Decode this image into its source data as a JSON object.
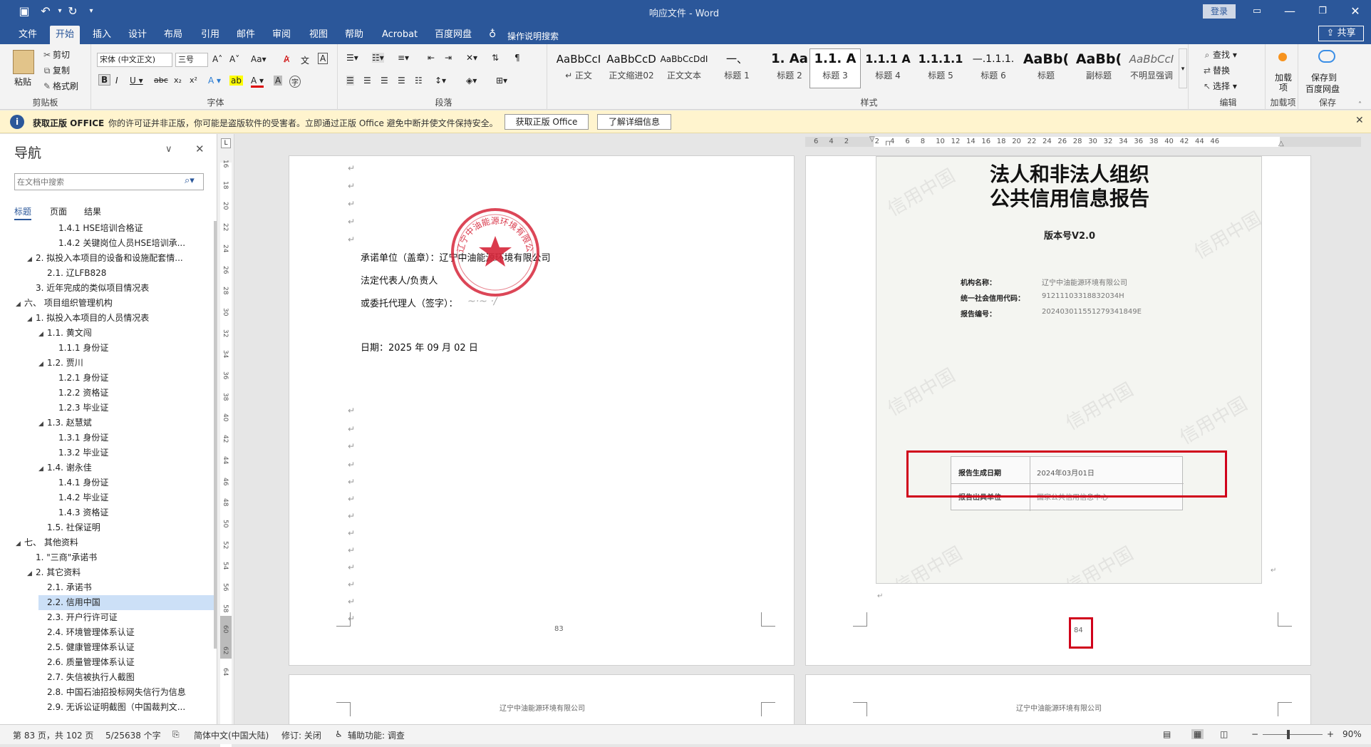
{
  "app": {
    "window_title": "响应文件 - Word",
    "login_label": "登录",
    "share_label": "共享",
    "colors": {
      "accent": "#2b579a",
      "message_bar": "#fff4ce",
      "red_box": "#d0021b"
    }
  },
  "tabs": [
    "文件",
    "开始",
    "插入",
    "设计",
    "布局",
    "引用",
    "邮件",
    "审阅",
    "视图",
    "帮助",
    "Acrobat",
    "百度网盘"
  ],
  "tell_me": "操作说明搜索",
  "ribbon": {
    "clipboard": {
      "paste": "粘贴",
      "cut": "剪切",
      "copy": "复制",
      "format_painter": "格式刷",
      "label": "剪贴板"
    },
    "font": {
      "font_name": "宋体 (中文正文)",
      "font_size": "三号",
      "label": "字体"
    },
    "paragraph": {
      "label": "段落"
    },
    "styles": {
      "label": "样式",
      "items": [
        {
          "preview": "AaBbCcI",
          "name": "↵ 正文"
        },
        {
          "preview": "AaBbCcD",
          "name": "正文缩进02"
        },
        {
          "preview": "AaBbCcDdI",
          "name": "正文文本"
        },
        {
          "preview": "一、",
          "name": "标题 1"
        },
        {
          "preview": "1. Aa",
          "name": "标题 2"
        },
        {
          "preview": "1.1. A",
          "name": "标题 3"
        },
        {
          "preview": "1.1.1 A",
          "name": "标题 4"
        },
        {
          "preview": "1.1.1.1",
          "name": "标题 5"
        },
        {
          "preview": "—.1.1.1.",
          "name": "标题 6"
        },
        {
          "preview": "AaBb(",
          "name": "标题"
        },
        {
          "preview": "AaBb(",
          "name": "副标题"
        },
        {
          "preview": "AaBbCcI",
          "name": "不明显强调"
        }
      ]
    },
    "editing": {
      "find": "查找",
      "replace": "替换",
      "select": "选择",
      "label": "编辑"
    },
    "addins": {
      "btn": "加载项",
      "label": "加载项"
    },
    "save": {
      "btn1": "保存到",
      "btn2": "百度网盘",
      "label": "保存"
    }
  },
  "message_bar": {
    "title": "获取正版 OFFICE",
    "text": "你的许可证并非正版，你可能是盗版软件的受害者。立即通过正版 Office 避免中断并使文件保持安全。",
    "btn_get": "获取正版 Office",
    "btn_learn": "了解详细信息"
  },
  "nav": {
    "title": "导航",
    "search_placeholder": "在文档中搜索",
    "tabs": [
      "标题",
      "页面",
      "结果"
    ],
    "items": [
      {
        "text": "1.4.1 HSE培训合格证",
        "level": 4,
        "tri": ""
      },
      {
        "text": "1.4.2 关键岗位人员HSE培训承...",
        "level": 4,
        "tri": ""
      },
      {
        "text": "2. 拟投入本项目的设备和设施配套情...",
        "level": 2,
        "tri": "◢"
      },
      {
        "text": "2.1. 辽LFB828",
        "level": 3,
        "tri": ""
      },
      {
        "text": "3. 近年完成的类似项目情况表",
        "level": 2,
        "tri": ""
      },
      {
        "text": "六、 项目组织管理机构",
        "level": 1,
        "tri": "◢"
      },
      {
        "text": "1. 拟投入本项目的人员情况表",
        "level": 2,
        "tri": "◢"
      },
      {
        "text": "1.1. 黄文闯",
        "level": 3,
        "tri": "◢"
      },
      {
        "text": "1.1.1 身份证",
        "level": 4,
        "tri": ""
      },
      {
        "text": "1.2. 贾川",
        "level": 3,
        "tri": "◢"
      },
      {
        "text": "1.2.1 身份证",
        "level": 4,
        "tri": ""
      },
      {
        "text": "1.2.2 资格证",
        "level": 4,
        "tri": ""
      },
      {
        "text": "1.2.3 毕业证",
        "level": 4,
        "tri": ""
      },
      {
        "text": "1.3. 赵慧斌",
        "level": 3,
        "tri": "◢"
      },
      {
        "text": "1.3.1 身份证",
        "level": 4,
        "tri": ""
      },
      {
        "text": "1.3.2 毕业证",
        "level": 4,
        "tri": ""
      },
      {
        "text": "1.4. 谢永佳",
        "level": 3,
        "tri": "◢"
      },
      {
        "text": "1.4.1 身份证",
        "level": 4,
        "tri": ""
      },
      {
        "text": "1.4.2 毕业证",
        "level": 4,
        "tri": ""
      },
      {
        "text": "1.4.3 资格证",
        "level": 4,
        "tri": ""
      },
      {
        "text": "1.5. 社保证明",
        "level": 3,
        "tri": ""
      },
      {
        "text": "七、 其他资料",
        "level": 1,
        "tri": "◢"
      },
      {
        "text": "1. \"三商\"承诺书",
        "level": 2,
        "tri": ""
      },
      {
        "text": "2. 其它资料",
        "level": 2,
        "tri": "◢"
      },
      {
        "text": "2.1. 承诺书",
        "level": 3,
        "tri": ""
      },
      {
        "text": "2.2. 信用中国",
        "level": 3,
        "tri": "",
        "selected": true
      },
      {
        "text": "2.3. 开户行许可证",
        "level": 3,
        "tri": ""
      },
      {
        "text": "2.4. 环境管理体系认证",
        "level": 3,
        "tri": ""
      },
      {
        "text": "2.5. 健康管理体系认证",
        "level": 3,
        "tri": ""
      },
      {
        "text": "2.6. 质量管理体系认证",
        "level": 3,
        "tri": ""
      },
      {
        "text": "2.7. 失信被执行人截图",
        "level": 3,
        "tri": ""
      },
      {
        "text": "2.8. 中国石油招投标网失信行为信息",
        "level": 3,
        "tri": ""
      },
      {
        "text": "2.9. 无诉讼证明截图（中国裁判文...",
        "level": 3,
        "tri": ""
      }
    ]
  },
  "hruler_ticks": [
    "6",
    "4",
    "2",
    "",
    "2",
    "4",
    "6",
    "8",
    "10",
    "12",
    "14",
    "16",
    "18",
    "20",
    "22",
    "24",
    "26",
    "28",
    "30",
    "32",
    "34",
    "36",
    "38",
    "40",
    "42",
    "44",
    "46"
  ],
  "vruler_ticks": [
    "16",
    "18",
    "20",
    "22",
    "24",
    "26",
    "28",
    "30",
    "32",
    "34",
    "36",
    "38",
    "40",
    "42",
    "44",
    "46",
    "48",
    "50",
    "52",
    "54",
    "56",
    "58",
    "60",
    "62",
    "64"
  ],
  "page83": {
    "unit": "承诺单位（盖章）：辽宁中油能源环境有限公司",
    "legal": "法定代表人/负责人",
    "agent": "或委托代理人（签字）：",
    "date": "日期：2025 年 09 月 02 日",
    "page_no": "83",
    "seal_text": "辽宁中油能源环境有限公司"
  },
  "page84": {
    "title1": "法人和非法人组织",
    "title2": "公共信用信息报告",
    "version": "版本号V2.0",
    "org_label": "机构名称：",
    "org_value": "辽宁中油能源环境有限公司",
    "code_label": "统一社会信用代码：",
    "code_value": "91211103318832034H",
    "report_label": "报告编号：",
    "report_value": "20240301155127934184​9E",
    "gen_date_label": "报告生成日期",
    "gen_date_value": "2024年03月01日",
    "issuer_label": "报告出具单位",
    "issuer_value": "国家公共信用信息中心",
    "page_no": "84",
    "watermark": "信用中国"
  },
  "footer_text": "辽宁中油能源环境有限公司",
  "status": {
    "page": "第 83 页，共 102 页",
    "words": "5/25638 个字",
    "lang": "简体中文(中国大陆)",
    "track": "修订: 关闭",
    "access": "辅助功能: 调查",
    "zoom": "90%"
  }
}
